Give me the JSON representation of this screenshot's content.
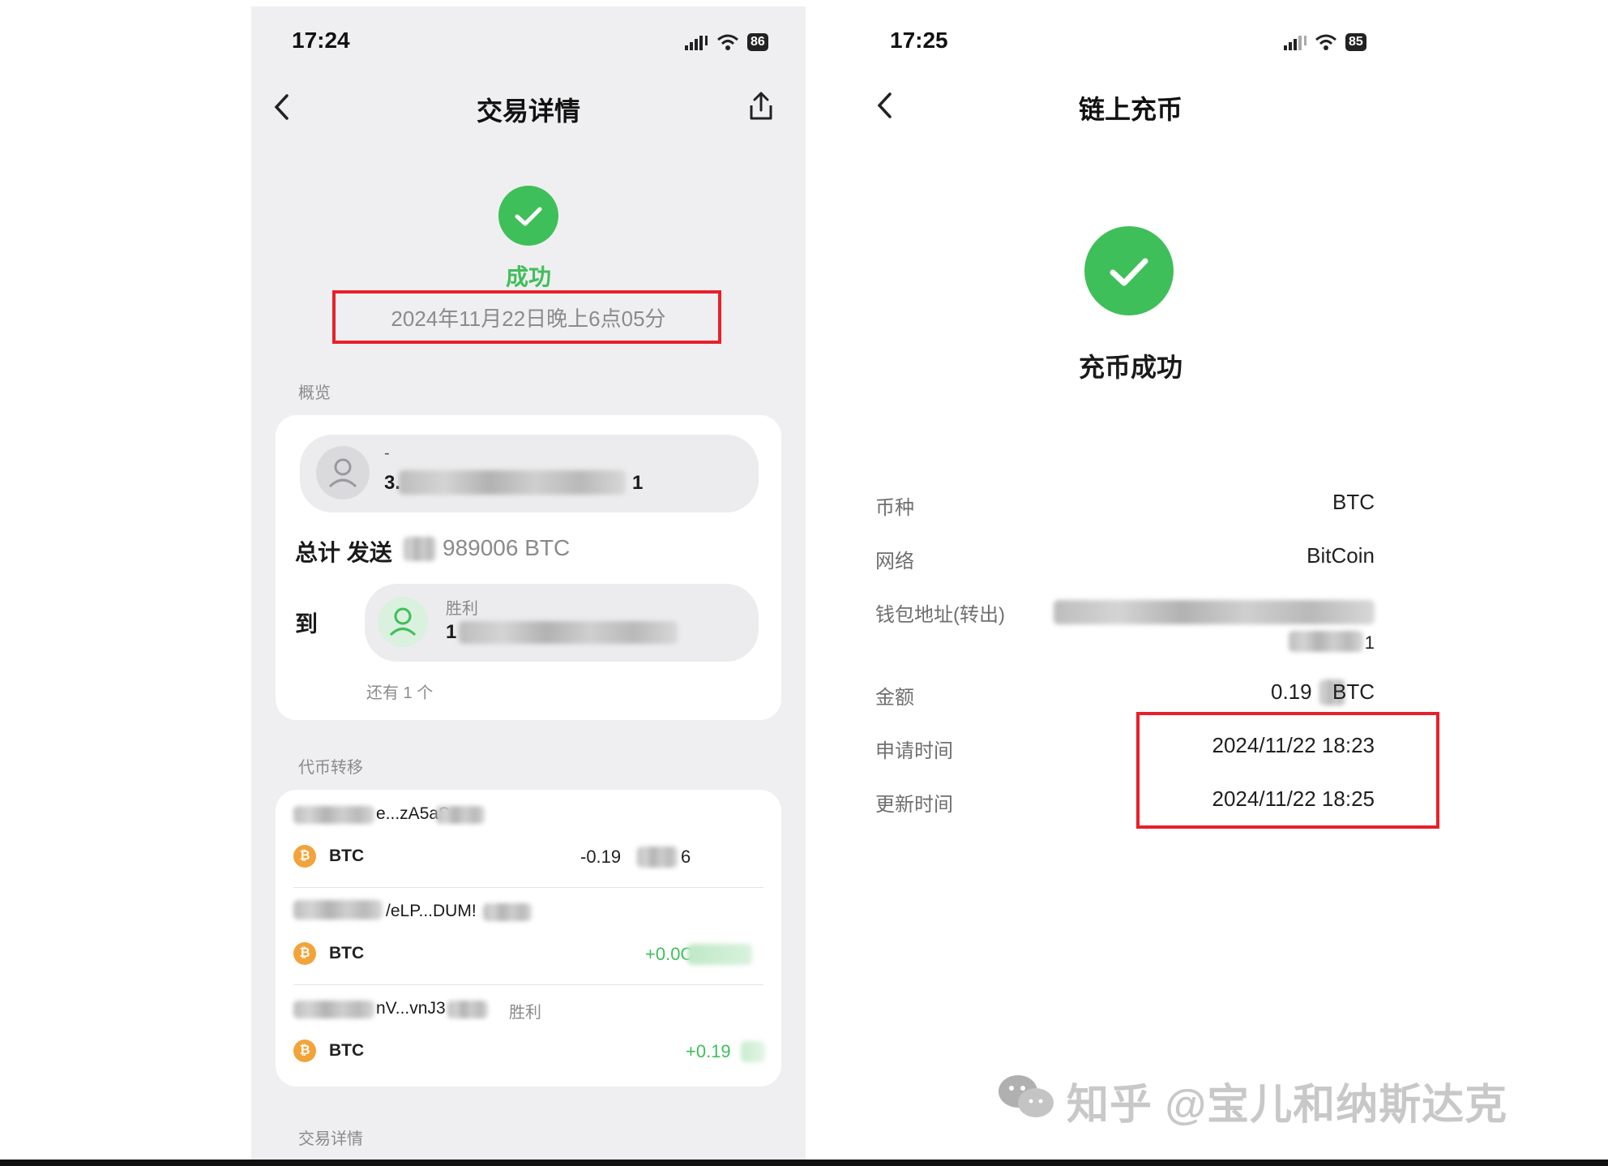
{
  "left": {
    "status_time": "17:24",
    "battery": "86",
    "title": "交易详情",
    "status": "成功",
    "datetime": "2024年11月22日晚上6点05分",
    "overview_label": "概览",
    "sender_name": "-",
    "sender_addr_start": "3.",
    "sender_addr_end": "1",
    "total_label": "总计 发送",
    "total_amount": "989006 BTC",
    "to_label": "到",
    "recipient_tag": "胜利",
    "recipient_addr_start": "1",
    "more_text": "还有 1 个",
    "token_transfer_label": "代币转移",
    "transfers": [
      {
        "address": "e...zA5aS",
        "coin": "BTC",
        "amount": "-0.19",
        "amount_suffix": "6",
        "sign_color": "#222222"
      },
      {
        "address": "/eLP...DUM!",
        "coin": "BTC",
        "amount": "+0.0C",
        "amount_suffix": "",
        "sign_color": "#3fbf59"
      },
      {
        "address": "nV...vnJ3",
        "tag": "胜利",
        "coin": "BTC",
        "amount": "+0.19",
        "amount_suffix": "",
        "sign_color": "#3fbf59"
      }
    ],
    "bottom_section_label": "交易详情"
  },
  "right": {
    "status_time": "17:25",
    "battery": "85",
    "title": "链上充币",
    "status": "充币成功",
    "rows": {
      "currency": {
        "label": "币种",
        "value": "BTC"
      },
      "network": {
        "label": "网络",
        "value": "BitCoin"
      },
      "wallet": {
        "label": "钱包地址(转出)",
        "value_tail": "1"
      },
      "amount": {
        "label": "金额",
        "value_start": "0.19",
        "value_end": "BTC"
      },
      "apply_time": {
        "label": "申请时间",
        "value": "2024/11/22 18:23"
      },
      "update_time": {
        "label": "更新时间",
        "value": "2024/11/22 18:25"
      }
    }
  },
  "watermark": "知乎 @宝儿和纳斯达克",
  "colors": {
    "success_green": "#3fbf59",
    "highlight_red": "#e8202a",
    "btc_orange": "#f2a33a"
  },
  "icons": [
    "back-icon",
    "share-icon",
    "check-icon",
    "user-icon",
    "btc-icon",
    "wechat-icon",
    "signal-icon",
    "wifi-icon"
  ]
}
